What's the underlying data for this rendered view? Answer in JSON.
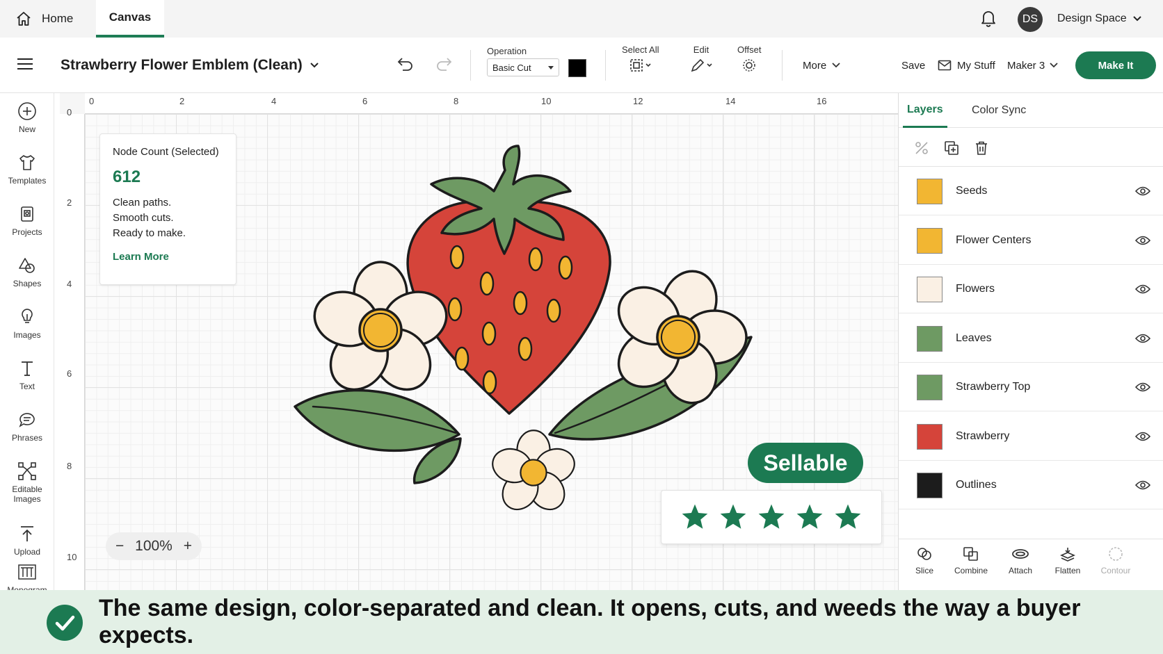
{
  "topbar": {
    "tabs": [
      {
        "label": "Home"
      },
      {
        "label": "Canvas"
      }
    ],
    "avatar_initials": "DS",
    "space_label": "Design Space"
  },
  "toolbar": {
    "project_title": "Strawberry Flower Emblem (Clean)",
    "operation_label": "Operation",
    "operation_value": "Basic Cut",
    "operation_color": "#000000",
    "select_all_label": "Select All",
    "edit_label": "Edit",
    "offset_label": "Offset",
    "more_label": "More",
    "save_label": "Save",
    "mystuff_label": "My Stuff",
    "machine_label": "Maker 3",
    "makeit_label": "Make It"
  },
  "rail": {
    "items": [
      {
        "label": "New",
        "icon": "plus-circle-icon"
      },
      {
        "label": "Templates",
        "icon": "tshirt-icon"
      },
      {
        "label": "Projects",
        "icon": "projects-icon"
      },
      {
        "label": "Shapes",
        "icon": "shapes-icon"
      },
      {
        "label": "Images",
        "icon": "lightbulb-icon"
      },
      {
        "label": "Text",
        "icon": "text-icon"
      },
      {
        "label": "Phrases",
        "icon": "speech-bubble-icon"
      },
      {
        "label": "Editable Images",
        "icon": "editable-images-icon"
      },
      {
        "label": "Upload",
        "icon": "upload-icon"
      },
      {
        "label": "Monogram",
        "icon": "monogram-icon"
      }
    ]
  },
  "canvas": {
    "ruler_top": [
      "0",
      "2",
      "4",
      "6",
      "8",
      "10",
      "12",
      "14",
      "16"
    ],
    "ruler_left": [
      "0",
      "2",
      "4",
      "6",
      "8",
      "10"
    ],
    "node_card": {
      "title": "Node Count (Selected)",
      "count": "612",
      "lines": [
        "Clean paths.",
        "Smooth cuts.",
        "Ready to make."
      ],
      "link": "Learn More"
    },
    "badge": "Sellable",
    "stars": 5,
    "zoom_minus": "−",
    "zoom": "100%",
    "zoom_plus": "+"
  },
  "panel": {
    "tabs": [
      {
        "label": "Layers"
      },
      {
        "label": "Color Sync"
      }
    ],
    "layers": [
      {
        "name": "Seeds",
        "color": "#f2b632"
      },
      {
        "name": "Flower Centers",
        "color": "#f2b632"
      },
      {
        "name": "Flowers",
        "color": "#faf0e4"
      },
      {
        "name": "Leaves",
        "color": "#6e9a63"
      },
      {
        "name": "Strawberry Top",
        "color": "#6e9a63"
      },
      {
        "name": "Strawberry",
        "color": "#d5443a"
      },
      {
        "name": "Outlines",
        "color": "#1c1c1c"
      }
    ],
    "actions": [
      {
        "label": "Slice",
        "icon": "slice-icon",
        "enabled": true
      },
      {
        "label": "Combine",
        "icon": "combine-icon",
        "enabled": true
      },
      {
        "label": "Attach",
        "icon": "attach-icon",
        "enabled": true
      },
      {
        "label": "Flatten",
        "icon": "flatten-icon",
        "enabled": true
      },
      {
        "label": "Contour",
        "icon": "contour-icon",
        "enabled": false
      }
    ]
  },
  "banner": {
    "text": "The same design, color-separated and clean. It opens, cuts, and weeds the way a buyer expects."
  },
  "colors": {
    "accent": "#1c7a52",
    "strawberry": "#d5443a",
    "leaf": "#6e9a63",
    "petal": "#faf0e4",
    "center": "#f2b632"
  }
}
